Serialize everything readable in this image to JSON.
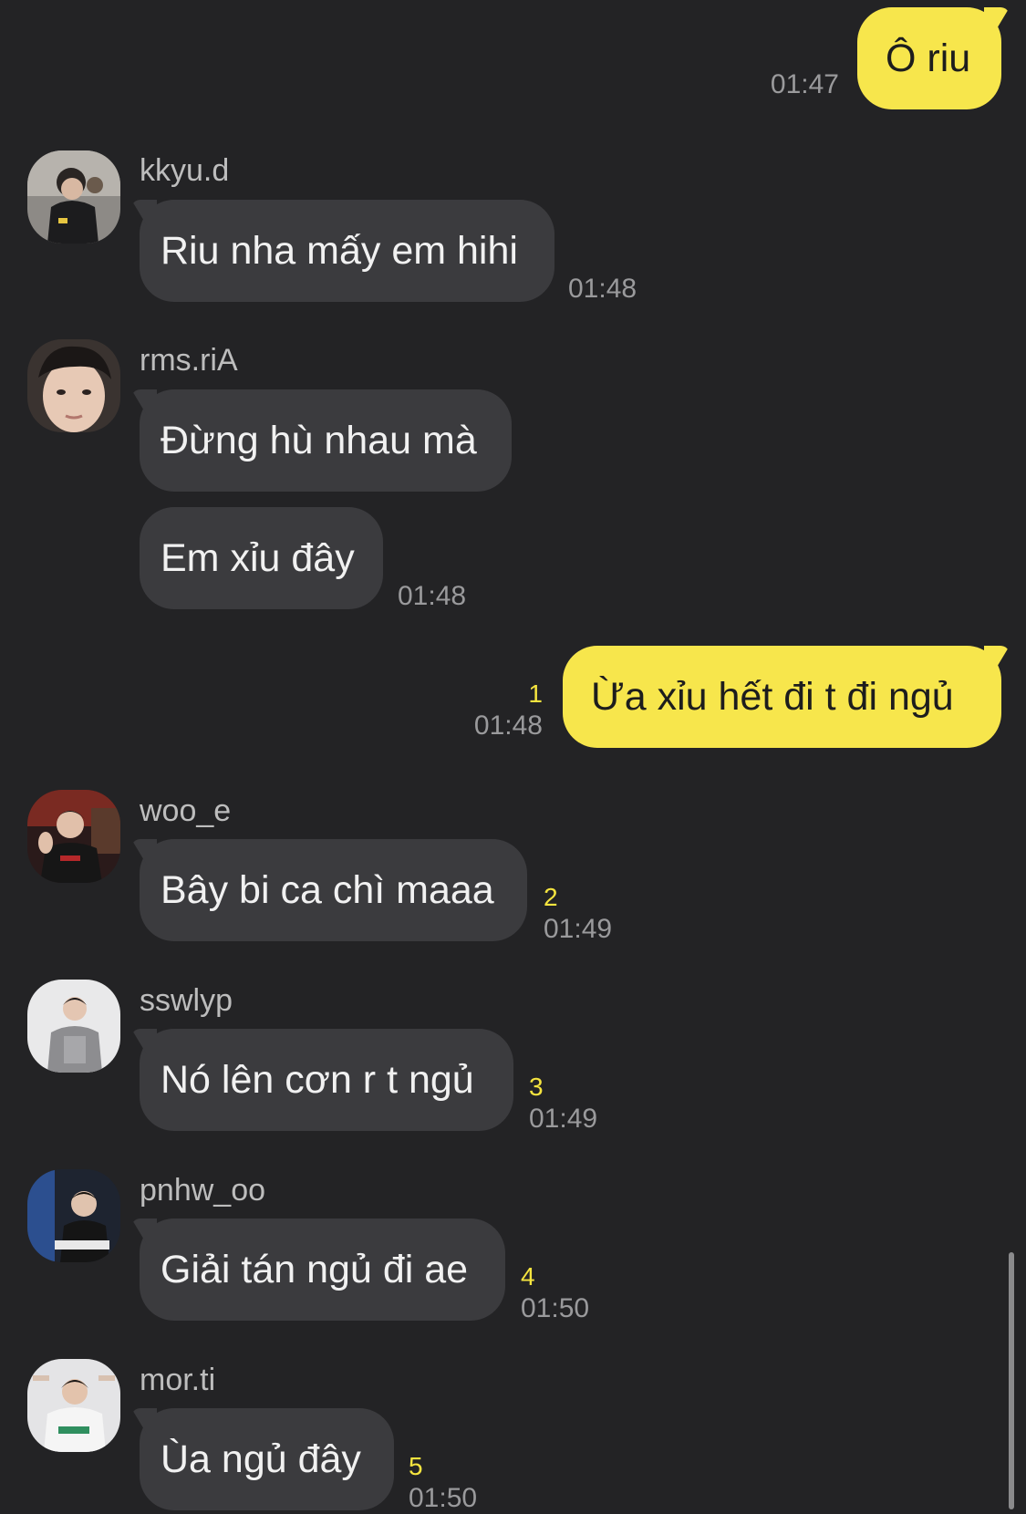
{
  "messages": {
    "m1": {
      "text": "Ô riu",
      "time": "01:47"
    },
    "m2": {
      "sender": "kkyu.d",
      "text": "Riu nha mấy em hihi",
      "time": "01:48"
    },
    "m3": {
      "sender": "rms.riA",
      "text": "Đừng hù nhau mà"
    },
    "m4": {
      "text": "Em xỉu đây",
      "time": "01:48"
    },
    "m5": {
      "text": "Ừa xỉu hết đi t đi ngủ",
      "unread": "1",
      "time": "01:48"
    },
    "m6": {
      "sender": "woo_e",
      "text": "Bây bi ca chì maaa",
      "unread": "2",
      "time": "01:49"
    },
    "m7": {
      "sender": "sswlyp",
      "text": "Nó lên cơn r t ngủ",
      "unread": "3",
      "time": "01:49"
    },
    "m8": {
      "sender": "pnhw_oo",
      "text": "Giải tán ngủ đi ae",
      "unread": "4",
      "time": "01:50"
    },
    "m9": {
      "sender": "mor.ti",
      "text": "Ùa ngủ đây",
      "unread": "5",
      "time": "01:50"
    }
  },
  "colors": {
    "background": "#232325",
    "outgoing_bubble": "#f7e64c",
    "incoming_bubble": "#3b3b3e",
    "unread_count": "#f5e43f"
  },
  "icons": {
    "avatar_kkyu_d": "profile-photo",
    "avatar_rms_riA": "profile-photo",
    "avatar_woo_e": "profile-photo",
    "avatar_sswlyp": "profile-photo",
    "avatar_pnhw_oo": "profile-photo",
    "avatar_mor_ti": "profile-photo"
  }
}
